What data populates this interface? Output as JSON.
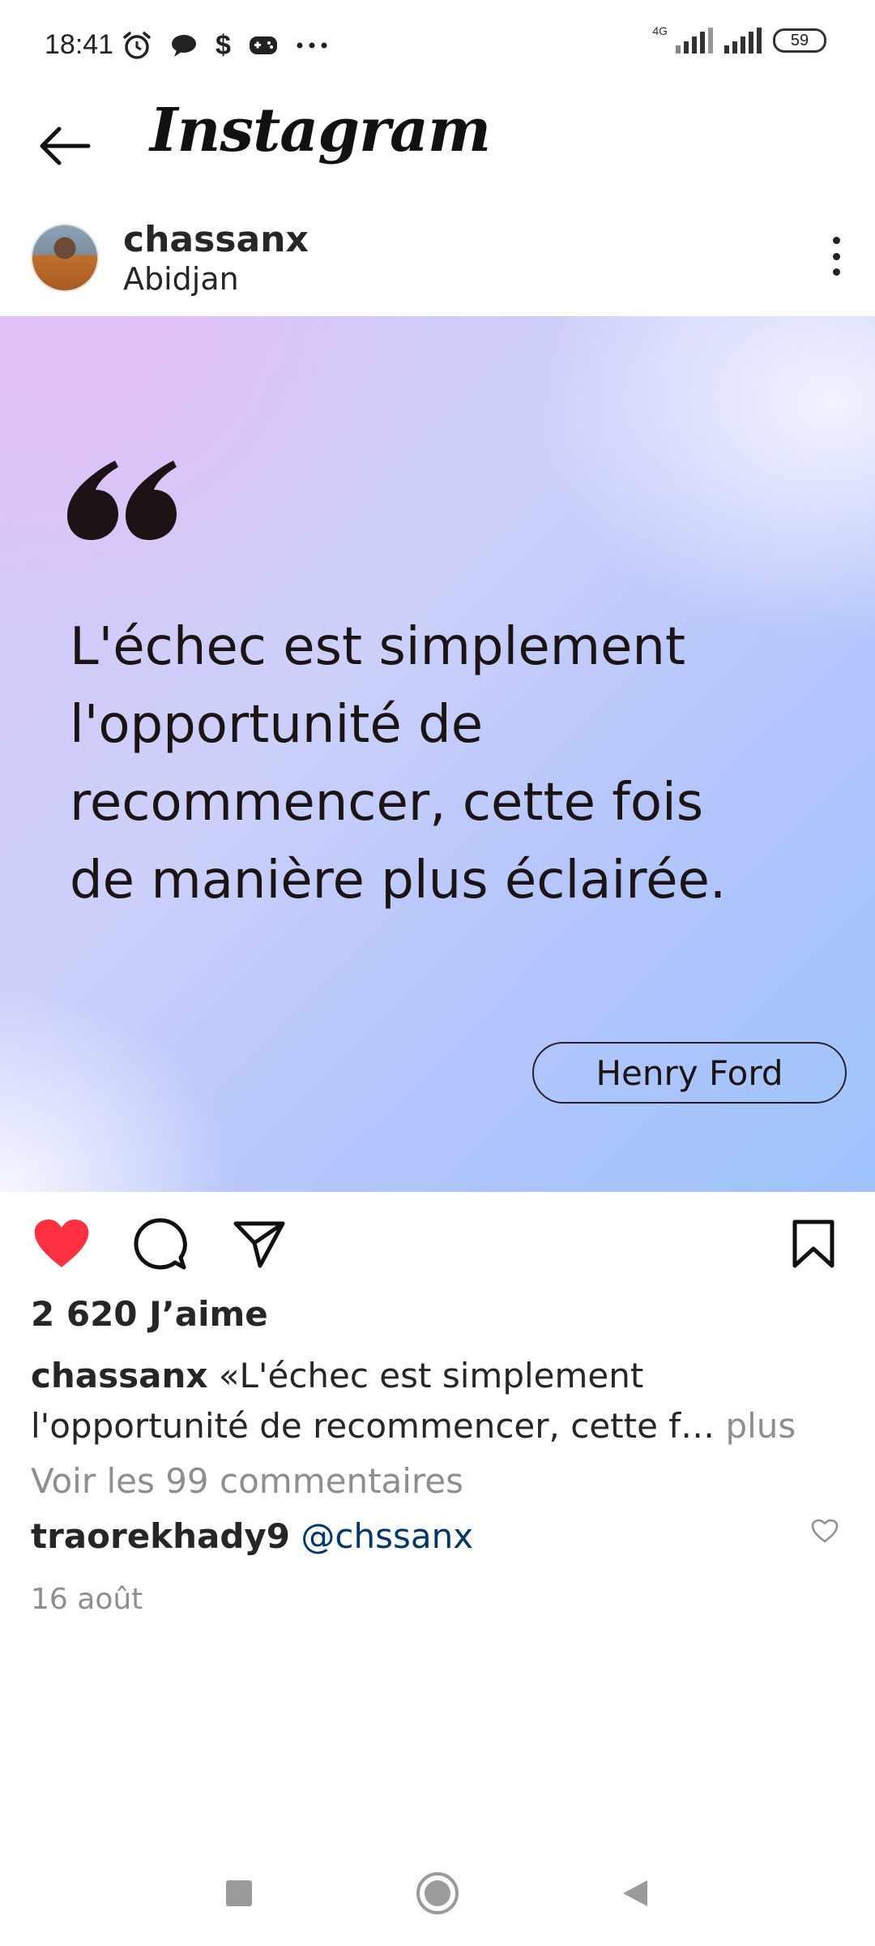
{
  "status_bar": {
    "time": "18:41",
    "network_label": "4G",
    "battery": "59",
    "icons": [
      "alarm-icon",
      "chat-bubble-icon",
      "dollar-icon",
      "gamepad-icon",
      "more-dots-icon"
    ]
  },
  "app_bar": {
    "title": "Instagram"
  },
  "post": {
    "username": "chassanx",
    "location": "Abidjan",
    "quote_lines": [
      "L'échec est simplement",
      "l'opportunité de",
      "recommencer, cette fois",
      "de manière plus éclairée."
    ],
    "author": "Henry Ford",
    "liked": true,
    "like_color": "#ff3040",
    "likes_text": "2 620 J’aime",
    "caption_user": "chassanx",
    "caption_text": " «L'échec est simplement l'opportunité de recommencer, cette f…",
    "caption_more": " plus",
    "view_comments": "Voir les 99 commentaires",
    "comment": {
      "user": "traorekhady9",
      "mention": "@chssanx"
    },
    "date": "16 août"
  }
}
